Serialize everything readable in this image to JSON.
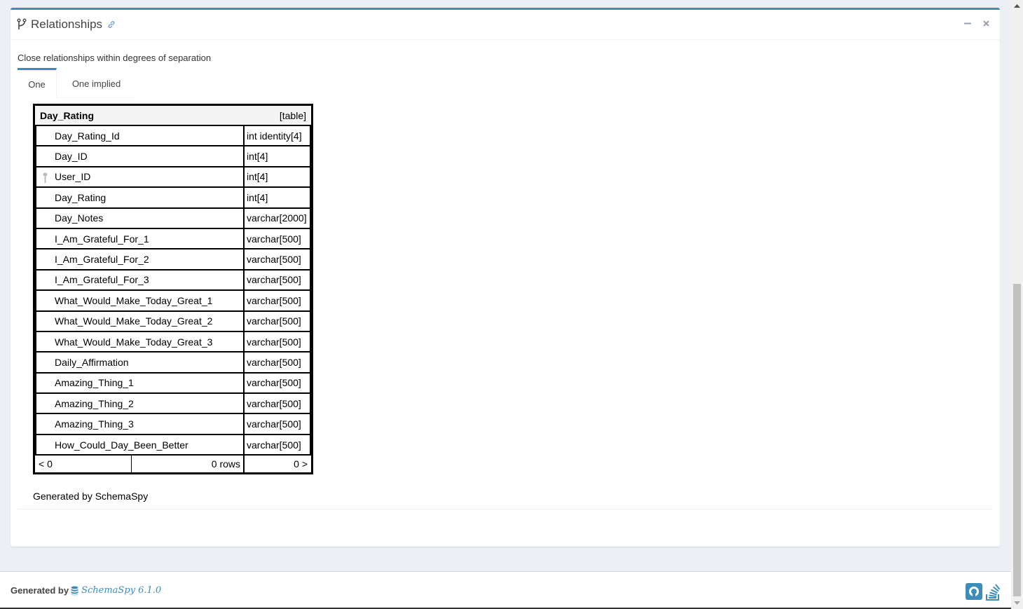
{
  "box": {
    "title": "Relationships",
    "icons": {
      "title": "code-fork-icon",
      "link": "link-icon",
      "minimize": "minus-icon",
      "close": "close-icon"
    }
  },
  "subtitle": "Close relationships within degrees of separation",
  "tabs": [
    {
      "label": "One",
      "active": true
    },
    {
      "label": "One implied",
      "active": false
    }
  ],
  "diagram": {
    "table_name": "Day_Rating",
    "table_kind": "[table]",
    "columns": [
      {
        "name": "Day_Rating_Id",
        "type": "int identity[4]",
        "key": false
      },
      {
        "name": "Day_ID",
        "type": "int[4]",
        "key": false
      },
      {
        "name": "User_ID",
        "type": "int[4]",
        "key": true
      },
      {
        "name": "Day_Rating",
        "type": "int[4]",
        "key": false
      },
      {
        "name": "Day_Notes",
        "type": "varchar[2000]",
        "key": false
      },
      {
        "name": "I_Am_Grateful_For_1",
        "type": "varchar[500]",
        "key": false
      },
      {
        "name": "I_Am_Grateful_For_2",
        "type": "varchar[500]",
        "key": false
      },
      {
        "name": "I_Am_Grateful_For_3",
        "type": "varchar[500]",
        "key": false
      },
      {
        "name": "What_Would_Make_Today_Great_1",
        "type": "varchar[500]",
        "key": false
      },
      {
        "name": "What_Would_Make_Today_Great_2",
        "type": "varchar[500]",
        "key": false
      },
      {
        "name": "What_Would_Make_Today_Great_3",
        "type": "varchar[500]",
        "key": false
      },
      {
        "name": "Daily_Affirmation",
        "type": "varchar[500]",
        "key": false
      },
      {
        "name": "Amazing_Thing_1",
        "type": "varchar[500]",
        "key": false
      },
      {
        "name": "Amazing_Thing_2",
        "type": "varchar[500]",
        "key": false
      },
      {
        "name": "Amazing_Thing_3",
        "type": "varchar[500]",
        "key": false
      },
      {
        "name": "How_Could_Day_Been_Better",
        "type": "varchar[500]",
        "key": false
      }
    ],
    "footer": {
      "parents": "< 0",
      "rows": "0 rows",
      "children": "0 >"
    },
    "generated_by": "Generated by SchemaSpy"
  },
  "footer": {
    "label": "Generated by",
    "brand": "SchemaSpy 6.1.0",
    "icons": [
      "database-icon",
      "github-icon",
      "stackoverflow-icon"
    ]
  },
  "colors": {
    "accent": "#3c8dbc",
    "background": "#ecf0f5"
  }
}
